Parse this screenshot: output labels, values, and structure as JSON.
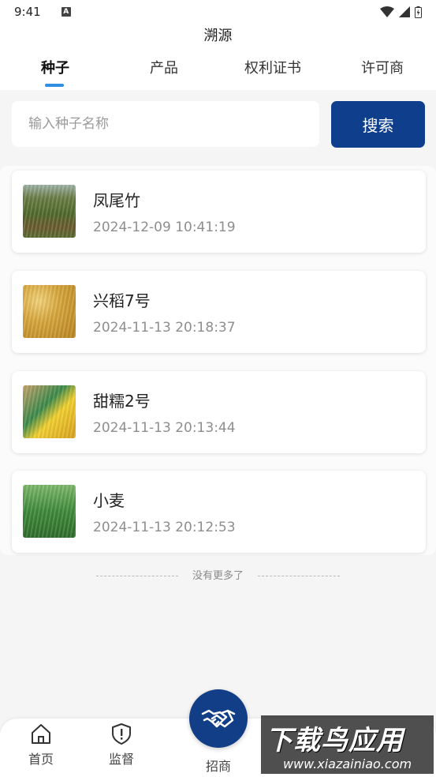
{
  "status_bar": {
    "time": "9:41",
    "notification_badge": "A"
  },
  "header": {
    "title": "溯源",
    "tabs": [
      {
        "label": "种子",
        "active": true
      },
      {
        "label": "产品",
        "active": false
      },
      {
        "label": "权利证书",
        "active": false
      },
      {
        "label": "许可商",
        "active": false
      }
    ]
  },
  "search": {
    "placeholder": "输入种子名称",
    "value": "",
    "button_label": "搜索"
  },
  "items": [
    {
      "name": "凤尾竹",
      "time": "2024-12-09 10:41:19",
      "thumb_icon": "bamboo-field-photo"
    },
    {
      "name": "兴稻7号",
      "time": "2024-11-13 20:18:37",
      "thumb_icon": "rice-grain-photo"
    },
    {
      "name": "甜糯2号",
      "time": "2024-11-13 20:13:44",
      "thumb_icon": "corn-seed-packet-photo"
    },
    {
      "name": "小麦",
      "time": "2024-11-13 20:12:53",
      "thumb_icon": "wheat-field-photo"
    }
  ],
  "list_footer": "没有更多了",
  "bottom_nav": {
    "home_label": "首页",
    "supervise_label": "监督",
    "center_label": "招商"
  },
  "watermark": {
    "main": "下载鸟应用",
    "sub": "www.xiazainiao.com"
  },
  "colors": {
    "accent": "#0f3f8c",
    "tab_indicator": "#2f8fe0",
    "background": "#f5f5f5"
  }
}
